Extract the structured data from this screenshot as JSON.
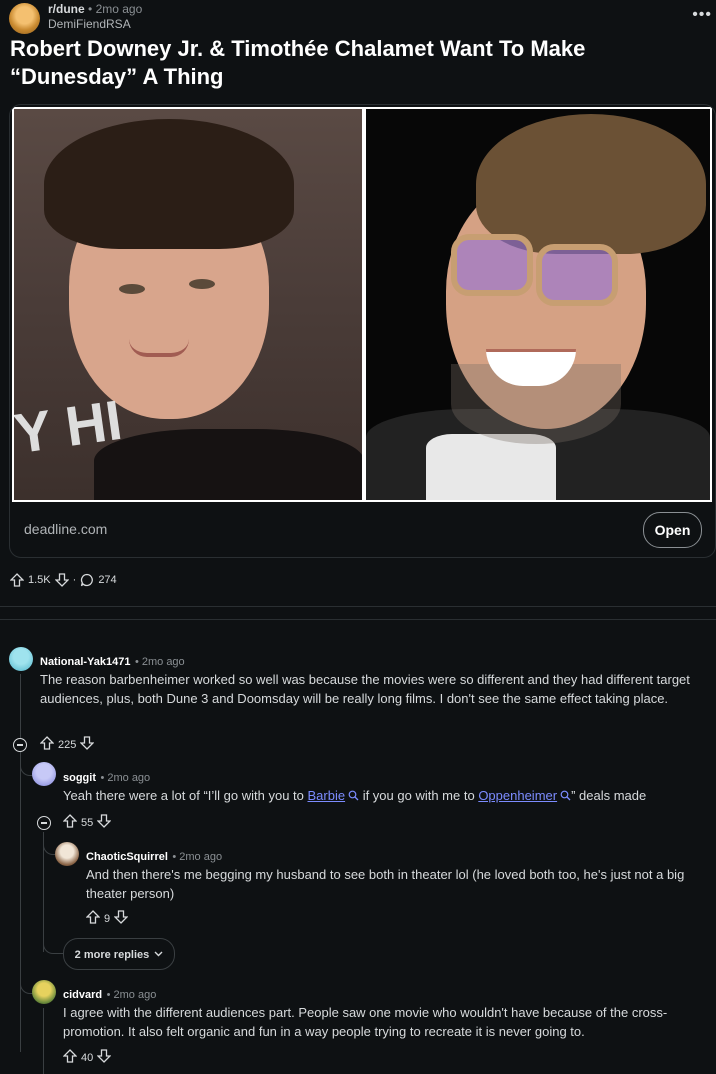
{
  "post": {
    "subreddit": "r/dune",
    "separator": "•",
    "time": "2mo ago",
    "author": "DemiFiendRSA",
    "title": "Robert Downey Jr. & Timothée Chalamet Want To Make “Dunesday” A Thing",
    "more_icon": "ellipsis-icon",
    "image_sign_text": "Y HI",
    "link_domain": "deadline.com",
    "open_label": "Open",
    "upvotes": "1.5K",
    "dot": "·",
    "comment_count": "274"
  },
  "comments": [
    {
      "author": "National-Yak1471",
      "time": "• 2mo ago",
      "body": "The reason barbenheimer worked so well was because the movies were so different and they had different target audiences, plus, both Dune 3 and Doomsday will be really long films. I don't see the same effect taking place.",
      "score": "225"
    },
    {
      "author": "soggit",
      "time": "• 2mo ago",
      "body_pre": "Yeah there were a lot of “I’ll go with you to ",
      "link1": "Barbie",
      "body_mid": " if you go with me to ",
      "link2": "Oppenheimer",
      "body_post": "” deals made",
      "score": "55"
    },
    {
      "author": "ChaoticSquirrel",
      "time": "• 2mo ago",
      "body": "And then there's me begging my husband to see both in theater lol (he loved both too, he's just not a big theater person)",
      "score": "9"
    },
    {
      "author": "cidvard",
      "time": "• 2mo ago",
      "body": "I agree with the different audiences part. People saw one movie who wouldn't have because of the cross-promotion. It also felt organic and fun in a way people trying to recreate it is never going to.",
      "score": "40"
    }
  ],
  "more_replies_label": "2 more replies",
  "colors": {
    "background": "#0e1113",
    "text": "#d7dadc",
    "link": "#7c8cff",
    "muted": "#8a8f93"
  }
}
